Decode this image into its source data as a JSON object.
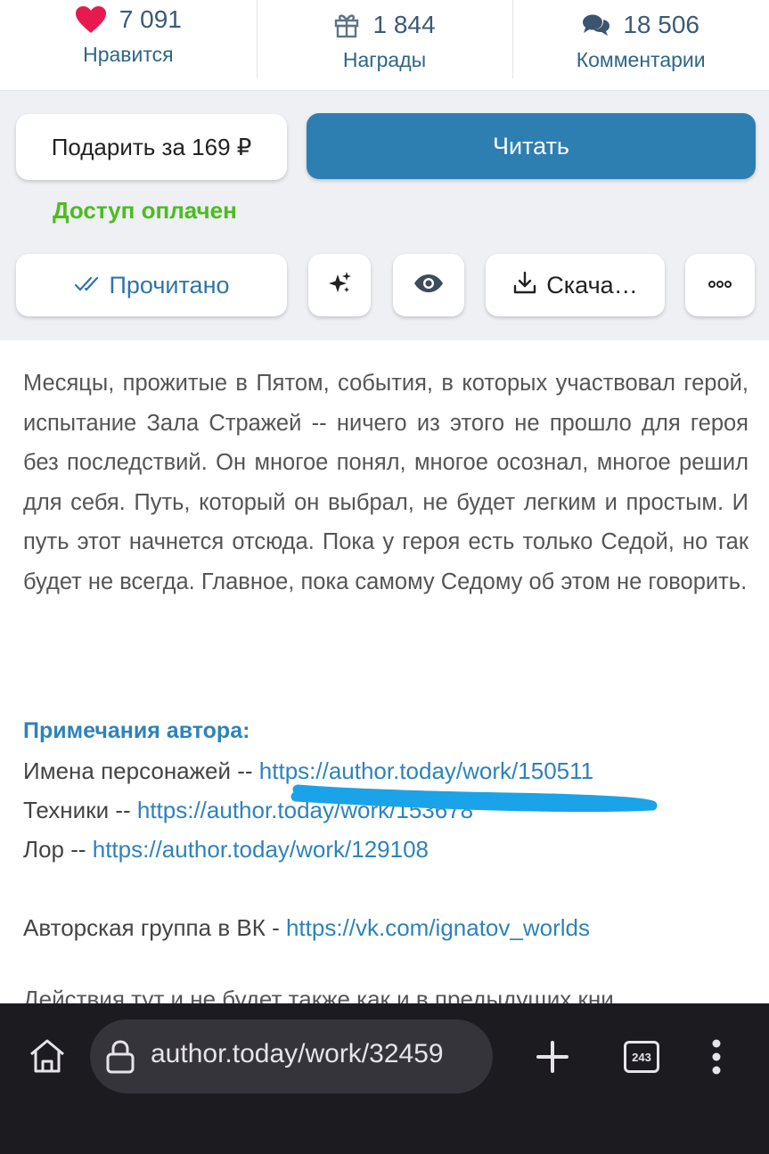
{
  "stats": [
    {
      "icon": "heart-icon",
      "value": "7 091",
      "label": "Нравится"
    },
    {
      "icon": "gift-icon",
      "value": "1 844",
      "label": "Награды"
    },
    {
      "icon": "comments-icon",
      "value": "18 506",
      "label": "Комментарии"
    }
  ],
  "actions": {
    "gift_label": "Подарить за 169 ₽",
    "read_label": "Читать",
    "paid_status": "Доступ оплачен",
    "done_label": "Прочитано",
    "download_label": "Скача…"
  },
  "description": "Месяцы, прожитые в Пятом, события, в которых участво­вал герой, испытание Зала Стражей -- ничего из этого не прошло для героя без последствий. Он многое понял, многое осознал, многое решил для себя. Путь, который он выбрал, не будет легким и простым. И путь этот начнется отсюда. Пока у героя есть только Седой, но так будет не всегда. Главное, пока самому Седому об этом не говорить.",
  "notes": {
    "title": "Примечания автора:",
    "lines": [
      {
        "prefix": "Имена персонажей -- ",
        "link": "https://author.today/work/150511"
      },
      {
        "prefix": "Техники -- ",
        "link": "https://author.today/work/153678"
      },
      {
        "prefix": "Лор -- ",
        "link": "https://author.today/work/129108"
      },
      {
        "prefix": "Авторская группа в ВК - ",
        "link": "https://vk.com/ignatov_worlds"
      }
    ],
    "cut_off": "Действия тут и не будет также как и в предыдущих кни"
  },
  "browser": {
    "url": "author.today/work/32459",
    "tab_count": "243"
  },
  "colors": {
    "accent": "#2d7fb2",
    "link": "#2e82bd",
    "paid": "#4cbc1e",
    "heart": "#e8194e",
    "scribble": "#1aa3e8"
  }
}
